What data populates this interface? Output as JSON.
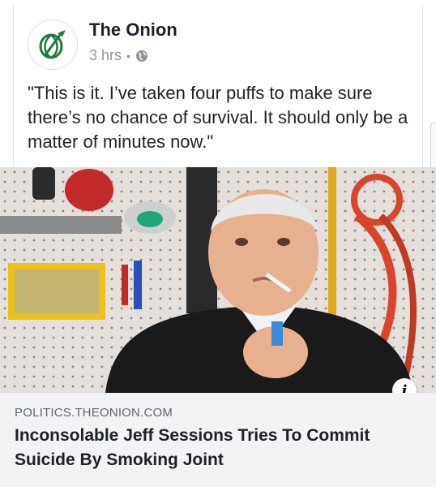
{
  "post": {
    "page_name": "The Onion",
    "timestamp": "3 hrs",
    "separator": "•",
    "privacy_icon": "globe-icon",
    "avatar_icon": "onion-logo",
    "text": "\"This is it. I’ve taken four puffs to make sure there’s no chance of survival. It should only be a matter of minutes now.\""
  },
  "link_preview": {
    "image_icon": "info-icon",
    "domain": "POLITICS.THEONION.COM",
    "headline": "Inconsolable Jeff Sessions Tries To Commit Suicide By Smoking Joint"
  },
  "colors": {
    "brand_green": "#1f7a3a",
    "text_primary": "#1d2129",
    "text_secondary": "#90949c",
    "link_bg": "#f2f3f5"
  }
}
